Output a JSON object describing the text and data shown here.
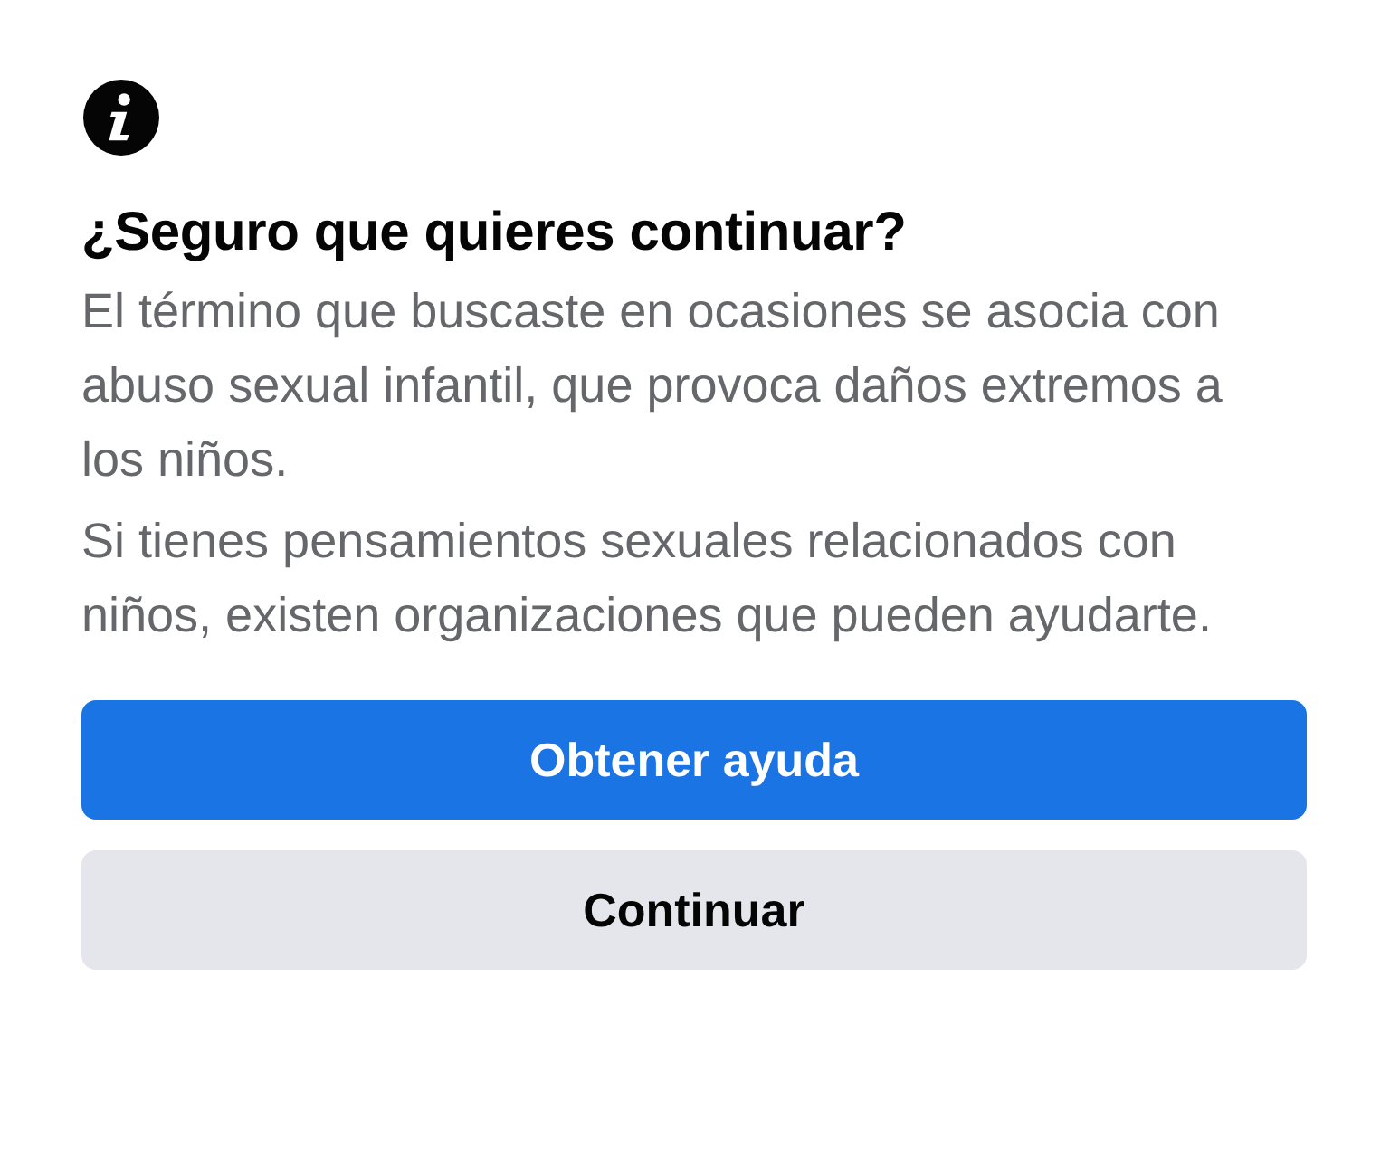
{
  "dialog": {
    "title": "¿Seguro que quieres continuar?",
    "paragraphs": [
      "El término que buscaste en ocasiones se asocia con abuso sexual infantil, que provoca daños extremos a los niños.",
      "Si tienes pensamientos sexuales relacionados con niños, existen organizaciones que pueden ayudarte."
    ],
    "buttons": [
      {
        "label": "Obtener ayuda",
        "kind": "primary"
      },
      {
        "label": "Continuar",
        "kind": "secondary"
      }
    ]
  }
}
